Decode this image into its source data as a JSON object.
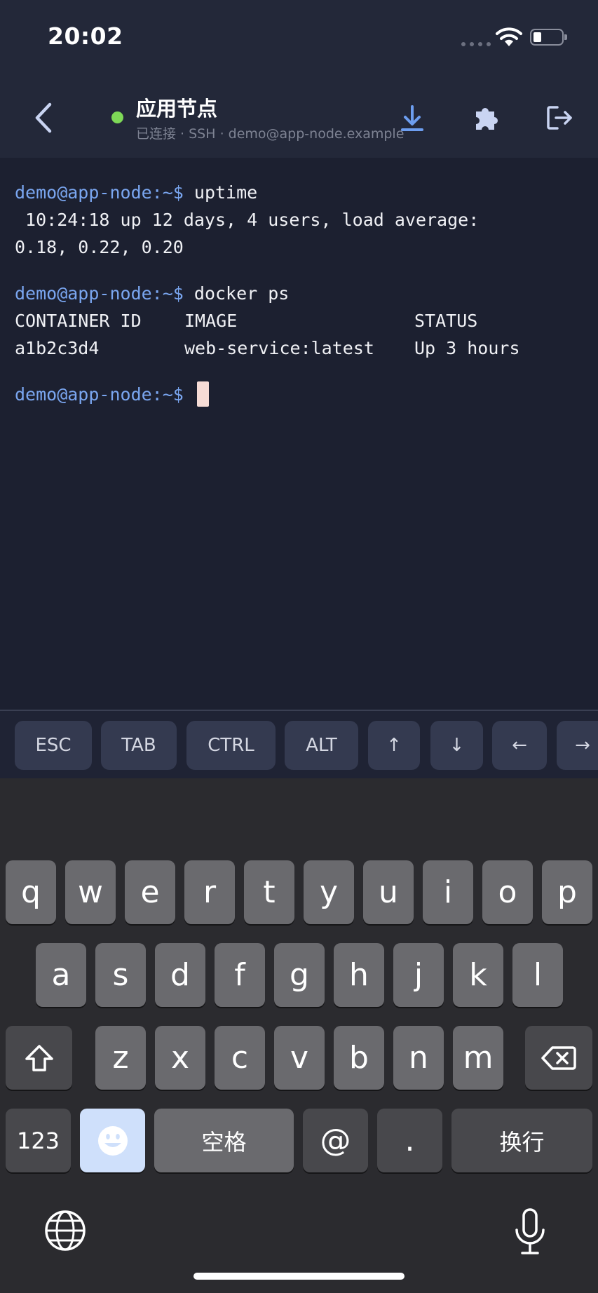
{
  "status_bar": {
    "time": "20:02",
    "icons": [
      "signal-dots-icon",
      "wifi-icon",
      "battery-icon"
    ]
  },
  "header": {
    "back_icon": "chevron-left-icon",
    "connection_status_color": "#7ed957",
    "title": "应用节点",
    "subtitle": "已连接 · SSH · demo@app-node.example",
    "actions": [
      "download-icon",
      "puzzle-icon",
      "logout-icon"
    ]
  },
  "terminal": {
    "prompt": "demo@app-node:~$",
    "cmd1": "uptime",
    "out1_line1": " 10:24:18 up 12 days, 4 users, load average:",
    "out1_line2": "0.18, 0.22, 0.20",
    "cmd2": "docker ps",
    "table_header": [
      "CONTAINER ID",
      "IMAGE",
      "STATUS"
    ],
    "table_row": [
      "a1b2c3d4",
      "web-service:latest",
      "Up 3 hours"
    ]
  },
  "extra_keys": [
    "ESC",
    "TAB",
    "CTRL",
    "ALT",
    "↑",
    "↓",
    "←",
    "→"
  ],
  "keyboard": {
    "row1": [
      "q",
      "w",
      "e",
      "r",
      "t",
      "y",
      "u",
      "i",
      "o",
      "p"
    ],
    "row2": [
      "a",
      "s",
      "d",
      "f",
      "g",
      "h",
      "j",
      "k",
      "l"
    ],
    "row3": [
      "z",
      "x",
      "c",
      "v",
      "b",
      "n",
      "m"
    ],
    "numbers_key": "123",
    "space_key": "空格",
    "at_key": "@",
    "period_key": ".",
    "return_key": "换行",
    "bottom_icons": [
      "globe-icon",
      "microphone-icon"
    ]
  },
  "colors": {
    "prompt": "#7aa6f0",
    "background": "#1c2030",
    "accent": "#7aa6f0"
  }
}
